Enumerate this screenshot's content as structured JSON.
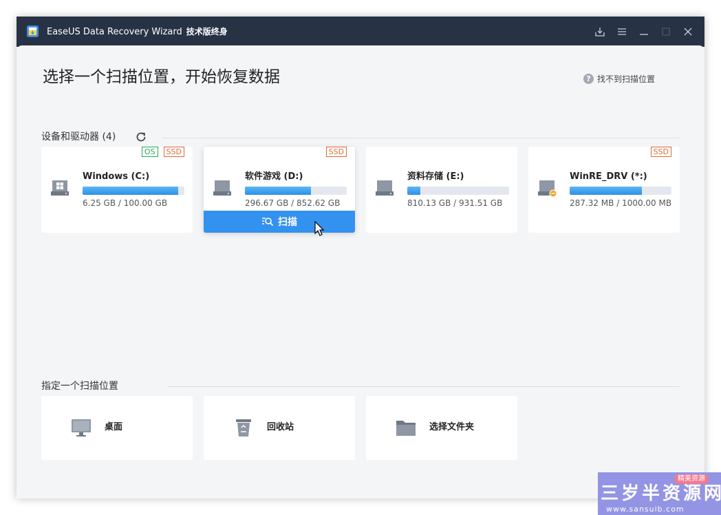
{
  "titlebar": {
    "app_name": "EaseUS Data Recovery Wizard",
    "edition": "技术版终身",
    "buttons": [
      "download-icon",
      "menu-icon",
      "minimize-icon",
      "maximize-icon",
      "close-icon"
    ]
  },
  "header": {
    "title": "选择一个扫描位置，开始恢复数据",
    "help_link": "找不到扫描位置"
  },
  "devices": {
    "section_title": "设备和驱动器 (4)",
    "drives": [
      {
        "name": "Windows (C:)",
        "size": "6.25 GB / 100.00 GB",
        "tags": [
          "OS",
          "SSD"
        ],
        "used_fraction": 0.94,
        "icon": "windows-drive-icon"
      },
      {
        "name": "软件游戏 (D:)",
        "size": "296.67 GB / 852.62 GB",
        "tags": [
          "SSD"
        ],
        "used_fraction": 0.65,
        "icon": "hard-drive-icon",
        "scan_label": "扫描",
        "hovered": true
      },
      {
        "name": "资料存储 (E:)",
        "size": "810.13 GB / 931.51 GB",
        "tags": [],
        "used_fraction": 0.13,
        "icon": "hard-drive-icon"
      },
      {
        "name": "WinRE_DRV (*:)",
        "size": "287.32 MB / 1000.00 MB",
        "tags": [
          "SSD"
        ],
        "used_fraction": 0.71,
        "icon": "warning-drive-icon"
      }
    ]
  },
  "locations": {
    "section_title": "指定一个扫描位置",
    "items": [
      {
        "label": "桌面",
        "icon": "desktop-icon"
      },
      {
        "label": "回收站",
        "icon": "recycle-bin-icon"
      },
      {
        "label": "选择文件夹",
        "icon": "folder-icon"
      }
    ]
  },
  "watermark": {
    "badge": "精美资源",
    "main": "三岁半资源网",
    "url": "www.sansuib.com"
  },
  "colors": {
    "titlebar": "#283245",
    "accent": "#3391f0",
    "os_tag": "#26a65b",
    "ssd_tag": "#e06a35"
  }
}
